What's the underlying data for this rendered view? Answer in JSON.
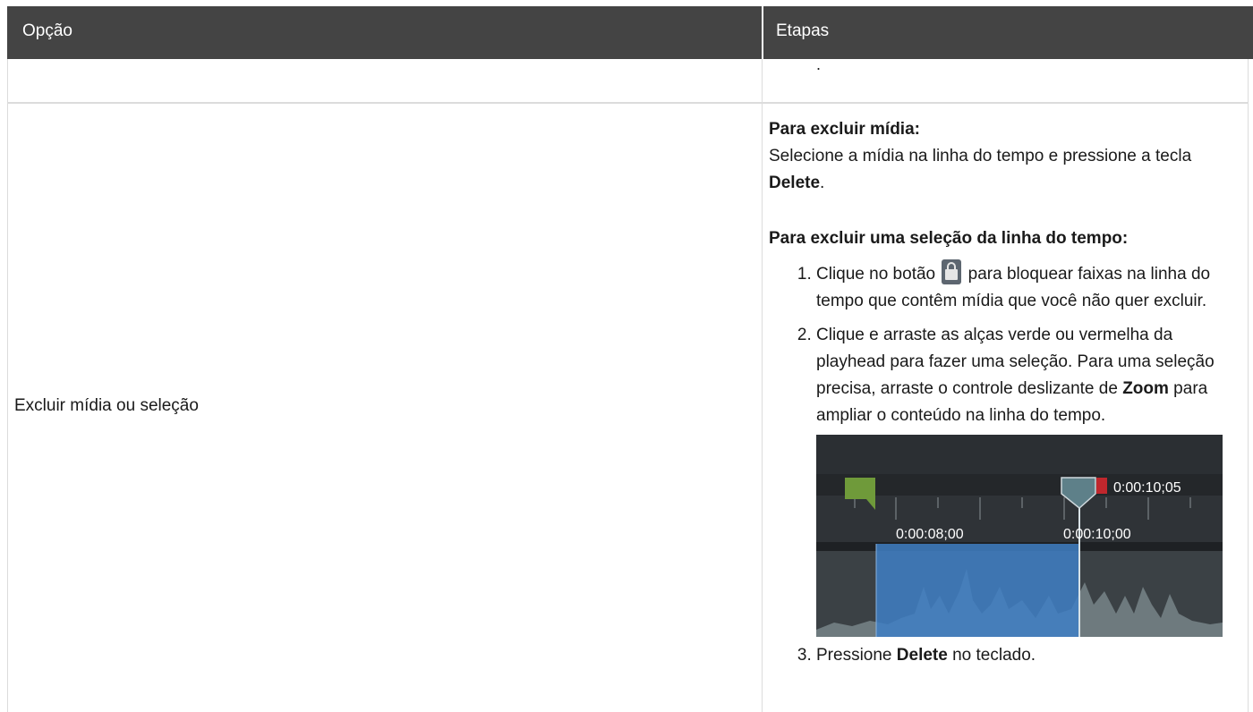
{
  "table": {
    "headers": [
      "Opção",
      "Etapas"
    ],
    "previous_row_stub": ".",
    "row": {
      "option": "Excluir mídia ou seleção",
      "media_heading": "Para excluir mídia:",
      "media_text_1": "Selecione a mídia na linha do tempo e pressione a tecla ",
      "media_key": "Delete",
      "media_text_2": ".",
      "selection_heading": "Para excluir uma seleção da linha do tempo:",
      "step1_a": "Clique no botão ",
      "step1_icon": "lock-icon",
      "step1_b": " para bloquear faixas na linha do tempo que contêm mídia que você não quer excluir.",
      "step2_a": "Clique e arraste as alças verde ou vermelha da playhead para fazer uma seleção. Para uma seleção precisa, arraste o controle deslizante de ",
      "step2_bold": "Zoom",
      "step2_b": " para ampliar o conteúdo na linha do tempo.",
      "step3_a": "Pressione ",
      "step3_bold": "Delete",
      "step3_b": " no teclado."
    }
  },
  "timeline_image": {
    "playhead_time": "0:00:10;05",
    "tick_label_1": "0:00:08;00",
    "tick_label_2": "0:00:10;00",
    "colors": {
      "background": "#2b2f33",
      "selection": "#3f7fc4",
      "in_marker": "#6f9a3a",
      "out_marker": "#c0272d",
      "playhead": "#5e8089",
      "waveform": "#6e7a7e"
    }
  }
}
